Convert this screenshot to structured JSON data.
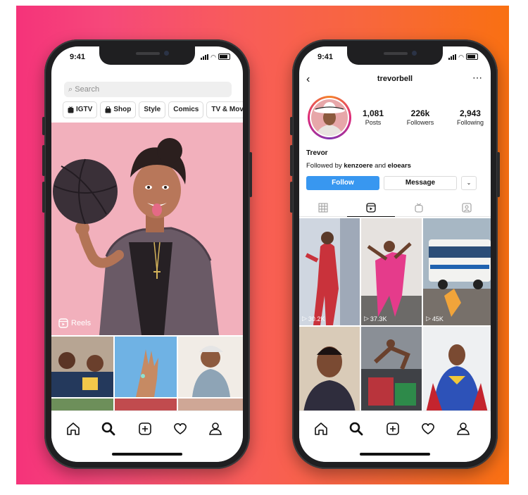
{
  "left_phone": {
    "status_time": "9:41",
    "search_placeholder": "Search",
    "chips": [
      {
        "label": "IGTV",
        "icon": "igtv-icon"
      },
      {
        "label": "Shop",
        "icon": "shop-bag-icon"
      },
      {
        "label": "Style",
        "icon": ""
      },
      {
        "label": "Comics",
        "icon": ""
      },
      {
        "label": "TV & Movie",
        "icon": ""
      }
    ],
    "reels_label": "Reels",
    "tabbar_icons": [
      "home-icon",
      "search-icon",
      "add-post-icon",
      "heart-icon",
      "profile-icon"
    ]
  },
  "right_phone": {
    "status_time": "9:41",
    "username": "trevorbell",
    "stats": [
      {
        "value": "1,081",
        "label": "Posts"
      },
      {
        "value": "226k",
        "label": "Followers"
      },
      {
        "value": "2,943",
        "label": "Following"
      }
    ],
    "display_name": "Trevor",
    "followed_by_prefix": "Followed by",
    "followed_by_user1": "kenzoere",
    "followed_by_and": "and",
    "followed_by_user2": "eloears",
    "follow_label": "Follow",
    "message_label": "Message",
    "profile_tabs": [
      "grid-icon",
      "reels-icon",
      "igtv-icon",
      "tagged-icon"
    ],
    "reel_views": [
      "30.2K",
      "37.3K",
      "45K"
    ],
    "tabbar_icons": [
      "home-icon",
      "search-icon",
      "add-post-icon",
      "heart-icon",
      "profile-icon"
    ]
  },
  "colors": {
    "gradient_start": "#f5337a",
    "gradient_end": "#f97012",
    "follow_blue": "#3897f0"
  }
}
